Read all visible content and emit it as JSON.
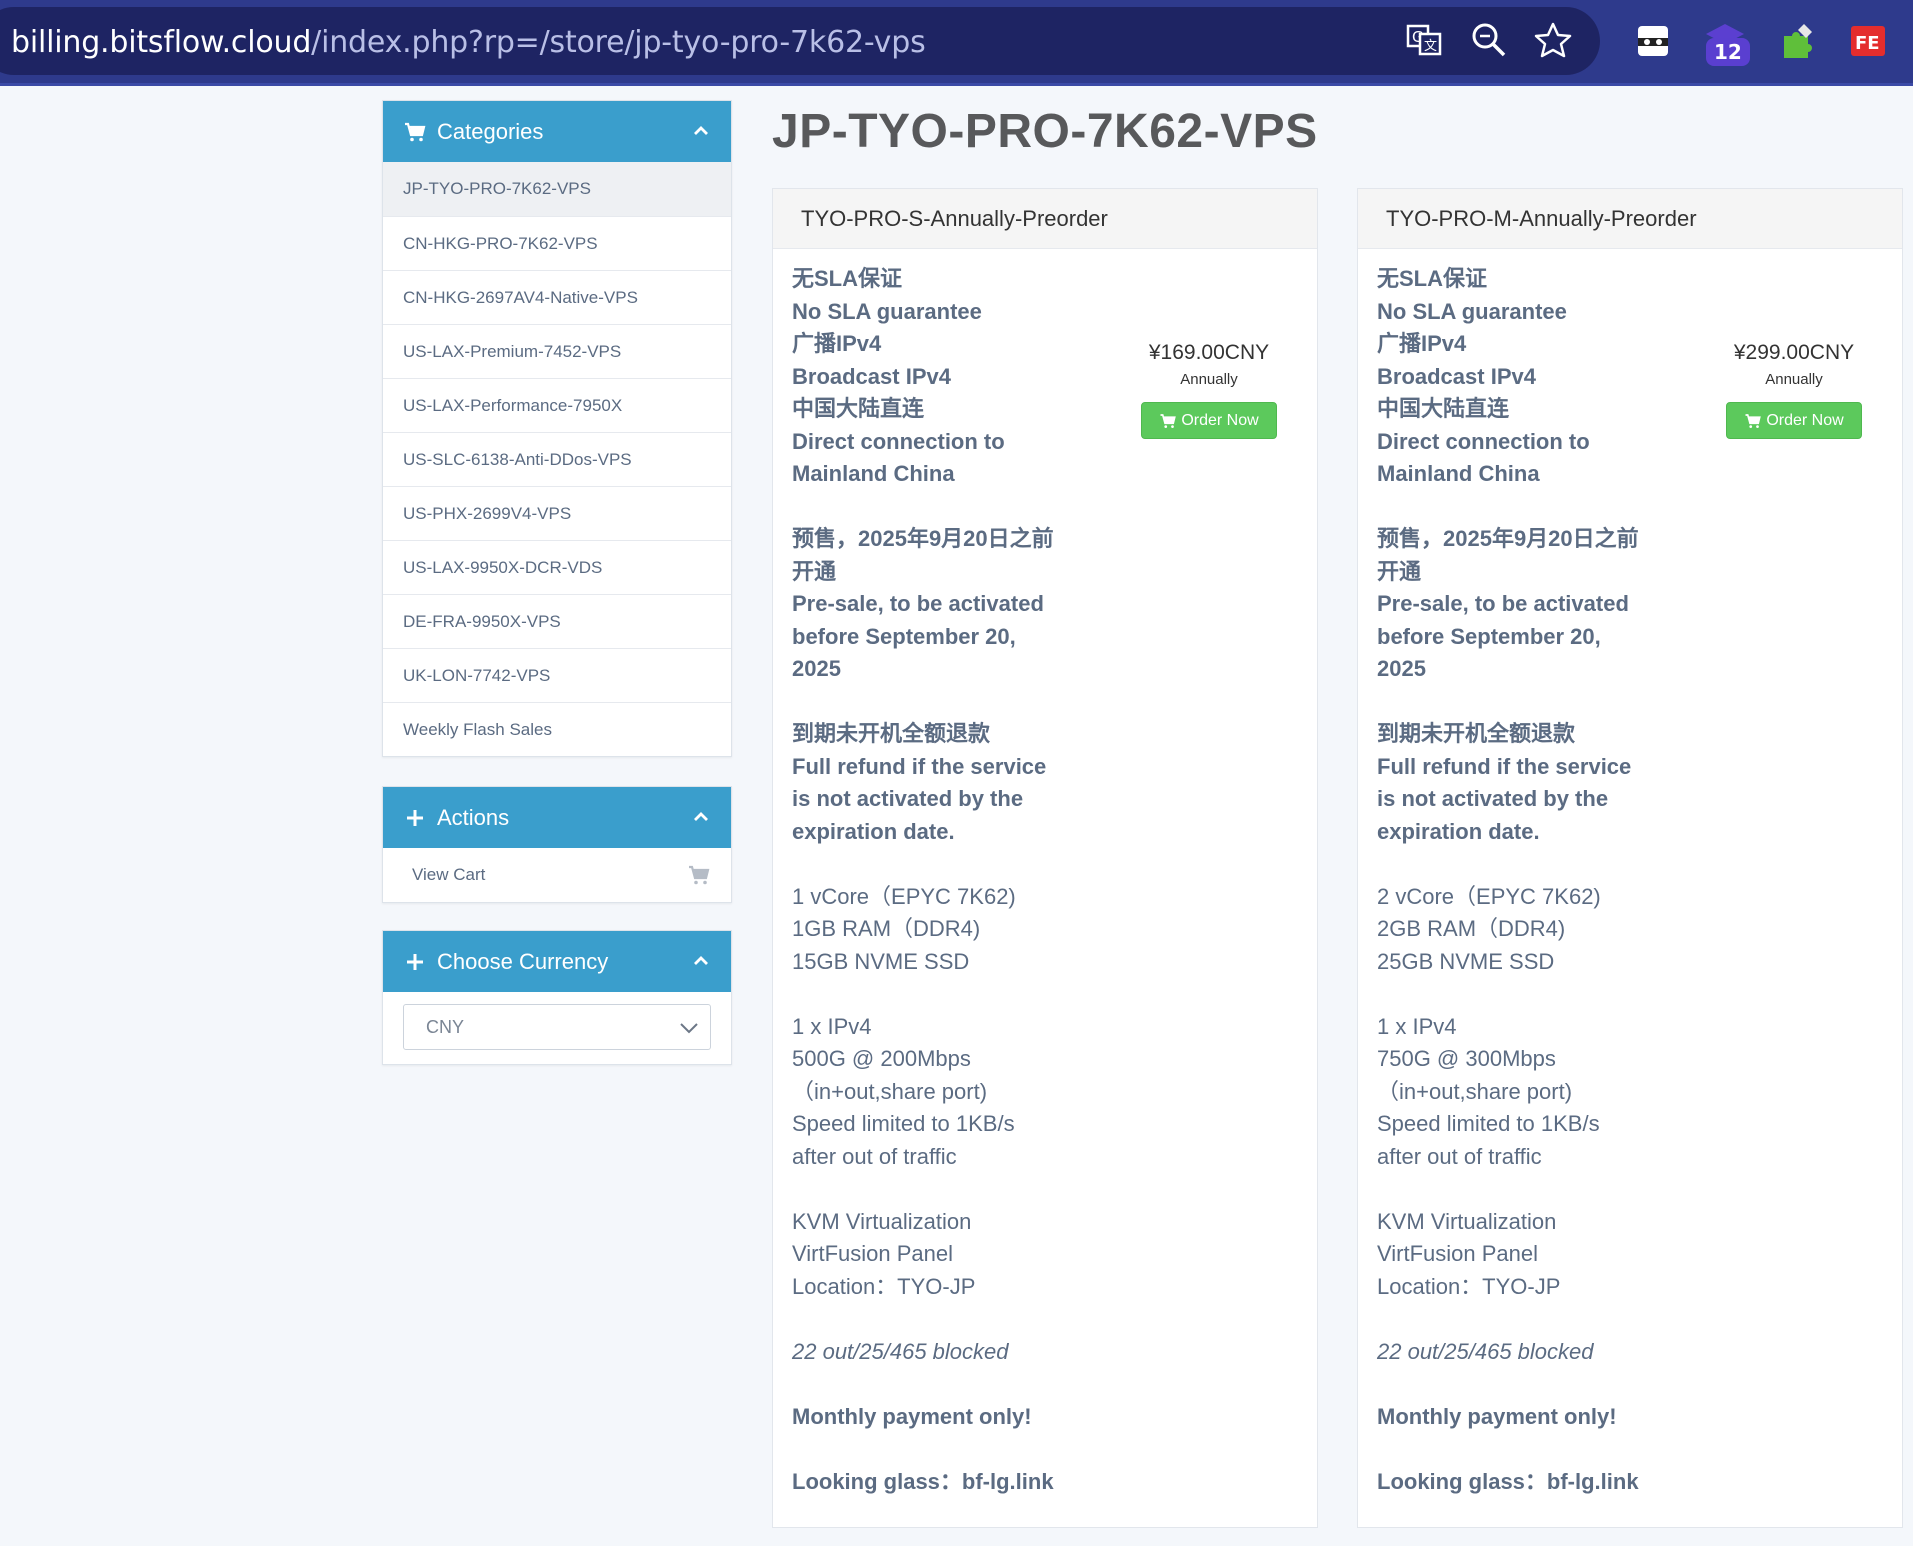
{
  "browser": {
    "url_host": "billing.bitsflow.cloud",
    "url_path": "/index.php?rp=/store/jp-tyo-pro-7k62-vps",
    "extension_badge": "12"
  },
  "sidebar": {
    "categories": {
      "title": "Categories",
      "items": [
        "JP-TYO-PRO-7K62-VPS",
        "CN-HKG-PRO-7K62-VPS",
        "CN-HKG-2697AV4-Native-VPS",
        "US-LAX-Premium-7452-VPS",
        "US-LAX-Performance-7950X",
        "US-SLC-6138-Anti-DDos-VPS",
        "US-PHX-2699V4-VPS",
        "US-LAX-9950X-DCR-VDS",
        "DE-FRA-9950X-VPS",
        "UK-LON-7742-VPS",
        "Weekly Flash Sales"
      ]
    },
    "actions": {
      "title": "Actions",
      "view_cart": "View Cart"
    },
    "currency": {
      "title": "Choose Currency",
      "selected": "CNY"
    }
  },
  "main": {
    "title": "JP-TYO-PRO-7K62-VPS",
    "products": [
      {
        "name": "TYO-PRO-S-Annually-Preorder",
        "price": "¥169.00CNY",
        "cycle": "Annually",
        "order_label": "Order Now",
        "lines": {
          "sla_cn": "无SLA保证",
          "sla_en": "No SLA guarantee",
          "ipv4_cn": "广播IPv4",
          "ipv4_en": "Broadcast IPv4",
          "direct_cn": "中国大陆直连",
          "direct_en1": "Direct connection to",
          "direct_en2": "Mainland China",
          "presale_cn1": "预售，2025年9月20日之前",
          "presale_cn2": "开通",
          "presale_en1": "Pre-sale, to be activated",
          "presale_en2": "before September 20,",
          "presale_en3": "2025",
          "refund_cn": "到期未开机全额退款",
          "refund_en1": "Full refund if the service",
          "refund_en2": "is not activated by the",
          "refund_en3": "expiration date.",
          "cpu": "1 vCore（EPYC 7K62)",
          "ram": "1GB RAM（DDR4)",
          "disk": "15GB NVME SSD",
          "ip": "1 x IPv4",
          "traffic": "500G @ 200Mbps",
          "port": "（in+out,share port)",
          "limit1": "Speed limited to 1KB/s",
          "limit2": "after out of traffic",
          "virt": "KVM Virtualization",
          "panel": "VirtFusion Panel",
          "location": "Location：TYO-JP",
          "blocked": "22 out/25/465 blocked",
          "monthly": "Monthly payment only!",
          "lg": "Looking glass：bf-lg.link"
        }
      },
      {
        "name": "TYO-PRO-M-Annually-Preorder",
        "price": "¥299.00CNY",
        "cycle": "Annually",
        "order_label": "Order Now",
        "lines": {
          "sla_cn": "无SLA保证",
          "sla_en": "No SLA guarantee",
          "ipv4_cn": "广播IPv4",
          "ipv4_en": "Broadcast IPv4",
          "direct_cn": "中国大陆直连",
          "direct_en1": "Direct connection to",
          "direct_en2": "Mainland China",
          "presale_cn1": "预售，2025年9月20日之前",
          "presale_cn2": "开通",
          "presale_en1": "Pre-sale, to be activated",
          "presale_en2": "before September 20,",
          "presale_en3": "2025",
          "refund_cn": "到期未开机全额退款",
          "refund_en1": "Full refund if the service",
          "refund_en2": "is not activated by the",
          "refund_en3": "expiration date.",
          "cpu": "2 vCore（EPYC 7K62)",
          "ram": "2GB RAM（DDR4)",
          "disk": "25GB NVME SSD",
          "ip": "1 x IPv4",
          "traffic": "750G @ 300Mbps",
          "port": "（in+out,share port)",
          "limit1": "Speed limited to 1KB/s",
          "limit2": "after out of traffic",
          "virt": "KVM Virtualization",
          "panel": "VirtFusion Panel",
          "location": "Location：TYO-JP",
          "blocked": "22 out/25/465 blocked",
          "monthly": "Monthly payment only!",
          "lg": "Looking glass：bf-lg.link"
        }
      }
    ]
  },
  "colors": {
    "header_blue": "#3a9ecc",
    "order_green": "#5cc95c",
    "browser_bar": "#2e3a8c"
  }
}
